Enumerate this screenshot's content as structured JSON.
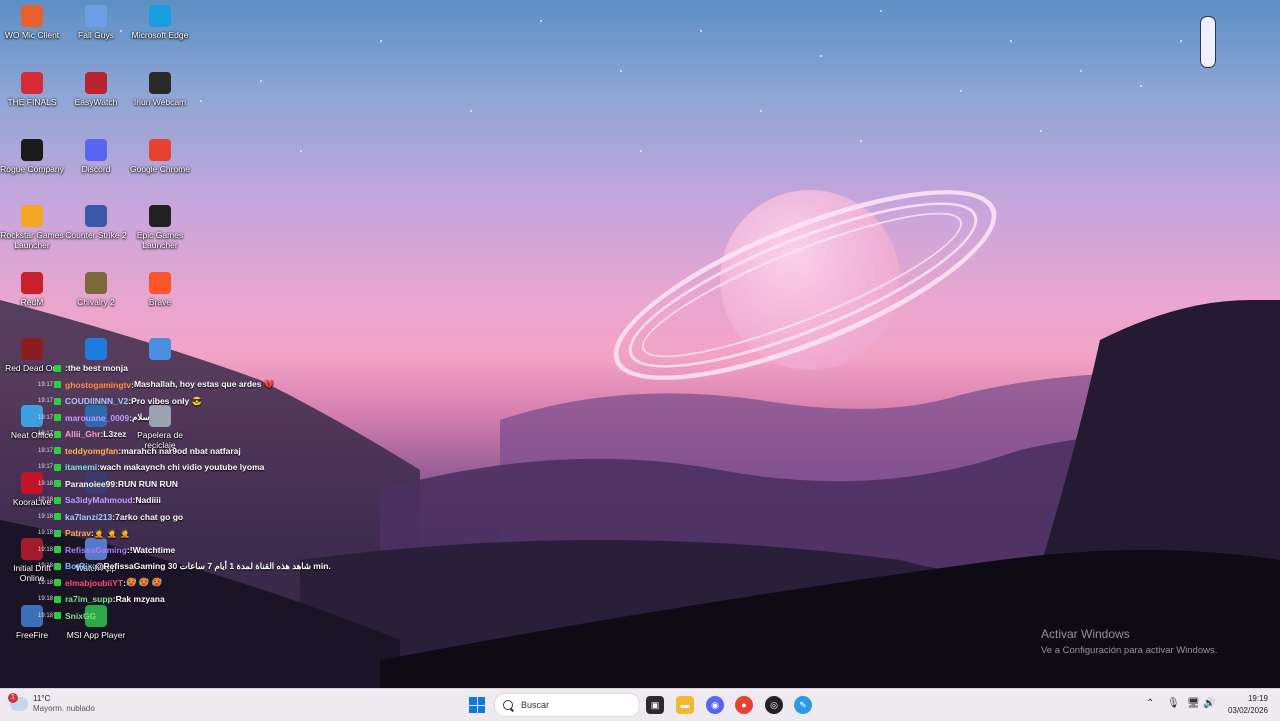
{
  "desktop_icons": [
    {
      "label": "WO Mic Client",
      "icon": "microphone-icon",
      "color": "#e7622a"
    },
    {
      "label": "Fall Guys",
      "icon": "fall-guys-icon",
      "color": "#6e9fe6"
    },
    {
      "label": "Microsoft Edge",
      "icon": "edge-icon",
      "color": "#1b9de2"
    },
    {
      "label": "THE FINALS",
      "icon": "the-finals-icon",
      "color": "#d62c3a"
    },
    {
      "label": "EasyWatch",
      "icon": "easywatch-icon",
      "color": "#b8232d"
    },
    {
      "label": "Iriun Webcam",
      "icon": "webcam-icon",
      "color": "#2a2a2a"
    },
    {
      "label": "Rogue Company",
      "icon": "rogue-company-icon",
      "color": "#1a1a1a"
    },
    {
      "label": "Discord",
      "icon": "discord-icon",
      "color": "#5865f2"
    },
    {
      "label": "Google Chrome",
      "icon": "chrome-icon",
      "color": "#e5432f"
    },
    {
      "label": "Rockstar Games Launcher",
      "icon": "rockstar-icon",
      "color": "#f5a623"
    },
    {
      "label": "Counter Strike 2",
      "icon": "counter-strike-icon",
      "color": "#3a5aa8"
    },
    {
      "label": "Epic Games Launcher",
      "icon": "epic-games-icon",
      "color": "#222222"
    },
    {
      "label": "RedM",
      "icon": "redm-icon",
      "color": "#c8202c"
    },
    {
      "label": "Chivalry 2",
      "icon": "chivalry-icon",
      "color": "#7a6a3a"
    },
    {
      "label": "Brave",
      "icon": "brave-icon",
      "color": "#fb542b"
    },
    {
      "label": "Red Dead Onl",
      "icon": "red-dead-icon",
      "color": "#8a1d1d"
    },
    {
      "label": "",
      "icon": "app-icon",
      "color": "#1c7ce0"
    },
    {
      "label": "",
      "icon": "app-icon-2",
      "color": "#4a8fe0"
    },
    {
      "label": "Neat Office",
      "icon": "neat-office-icon",
      "color": "#3aa0e0"
    },
    {
      "label": "",
      "icon": "app-icon-3",
      "color": "#2b6cb0"
    },
    {
      "label": "Papelera de reciclaje",
      "icon": "recycle-bin-icon",
      "color": "#9aa4b0"
    },
    {
      "label": "KooraLive",
      "icon": "kooralive-icon",
      "color": "#c0142b"
    },
    {
      "label": "",
      "icon": "app-icon-4",
      "color": "#3b3b6b"
    },
    {
      "label": "Initial Drift Online",
      "icon": "initial-drift-icon",
      "color": "#a21b2d"
    },
    {
      "label": "Watch App",
      "icon": "watch-app-icon",
      "color": "#5878c8"
    },
    {
      "label": "FreeFire",
      "icon": "freefire-icon",
      "color": "#3b6fb8"
    },
    {
      "label": "MSI App Player",
      "icon": "msi-app-player-icon",
      "color": "#2aa84a"
    }
  ],
  "chat": [
    {
      "time": "",
      "user": "",
      "user_color": "#b8a0ff",
      "badge": "#2ecc40",
      "message": "the best monja"
    },
    {
      "time": "19:17",
      "user": "ghostogamingtv",
      "user_color": "#ff8a3d",
      "badge": "#2ecc40",
      "message": "Mashallah, hoy estas que ardes 💔"
    },
    {
      "time": "19:17",
      "user": "COUDIINNN_V2",
      "user_color": "#a0c8ff",
      "badge": "#2ecc40",
      "message": "Pro vibes only 😎"
    },
    {
      "time": "19:17",
      "user": "marouane_0009",
      "user_color": "#c49bff",
      "badge": "#2ecc40",
      "message": "سلام"
    },
    {
      "time": "19:17",
      "user": "Allii_Ghr",
      "user_color": "#ff9ad2",
      "badge": "#2ecc40",
      "message": "L3zez"
    },
    {
      "time": "19:17",
      "user": "teddyomgfan",
      "user_color": "#ffb347",
      "badge": "#2ecc40",
      "message": "marahch nar9od nbat natfaraj"
    },
    {
      "time": "19:17",
      "user": "itamemi",
      "user_color": "#7fe3d8",
      "badge": "#2ecc40",
      "message": "wach makaynch chi vidio youtube lyoma"
    },
    {
      "time": "19:18",
      "user": "Paranoiee99",
      "user_color": "#f0f0f0",
      "badge": "#2ecc40",
      "message": "RUN RUN RUN"
    },
    {
      "time": "19:18",
      "user": "Sa3idyMahmoud",
      "user_color": "#c49bff",
      "badge": "#2ecc40",
      "message": "Nadiiii"
    },
    {
      "time": "19:18",
      "user": "ka7lanzi213",
      "user_color": "#9ad0ff",
      "badge": "#2ecc40",
      "message": "7arko chat go go"
    },
    {
      "time": "19:18",
      "user": "Patrav",
      "user_color": "#ffa84a",
      "badge": "#2ecc40",
      "message": "🤦 🤦 🤦"
    },
    {
      "time": "19:18",
      "user": "RefissaGaming",
      "user_color": "#b07aff",
      "badge": "#2ecc40",
      "message": "!Watchtime"
    },
    {
      "time": "19:18",
      "user": "BotRix",
      "user_color": "#7fb8ff",
      "badge": "#2ecc40",
      "message": "@RefissaGaming شاهد هذه القناة لمدة 1 أيام 7 ساعات 30 min."
    },
    {
      "time": "19:18",
      "user": "elmabjoubiiYT",
      "user_color": "#ff4d6d",
      "badge": "#2ecc40",
      "message": "🥵 🥵 🥵"
    },
    {
      "time": "19:18",
      "user": "ra7im_supp",
      "user_color": "#7fe07f",
      "badge": "#2ecc40",
      "message": "Rak mzyana"
    },
    {
      "time": "19:18",
      "user": "SnixGG",
      "user_color": "#7fe07f",
      "badge": "#2ecc40",
      "message": ""
    }
  ],
  "watermark": {
    "title": "Activar Windows",
    "subtitle": "Ve a Configuración para activar Windows."
  },
  "taskbar": {
    "weather_temp": "11°C",
    "weather_condition": "Mayorm. nublado",
    "weather_badge": "1",
    "search_placeholder": "Buscar",
    "time": "19:19",
    "date": "03/02/2026"
  }
}
